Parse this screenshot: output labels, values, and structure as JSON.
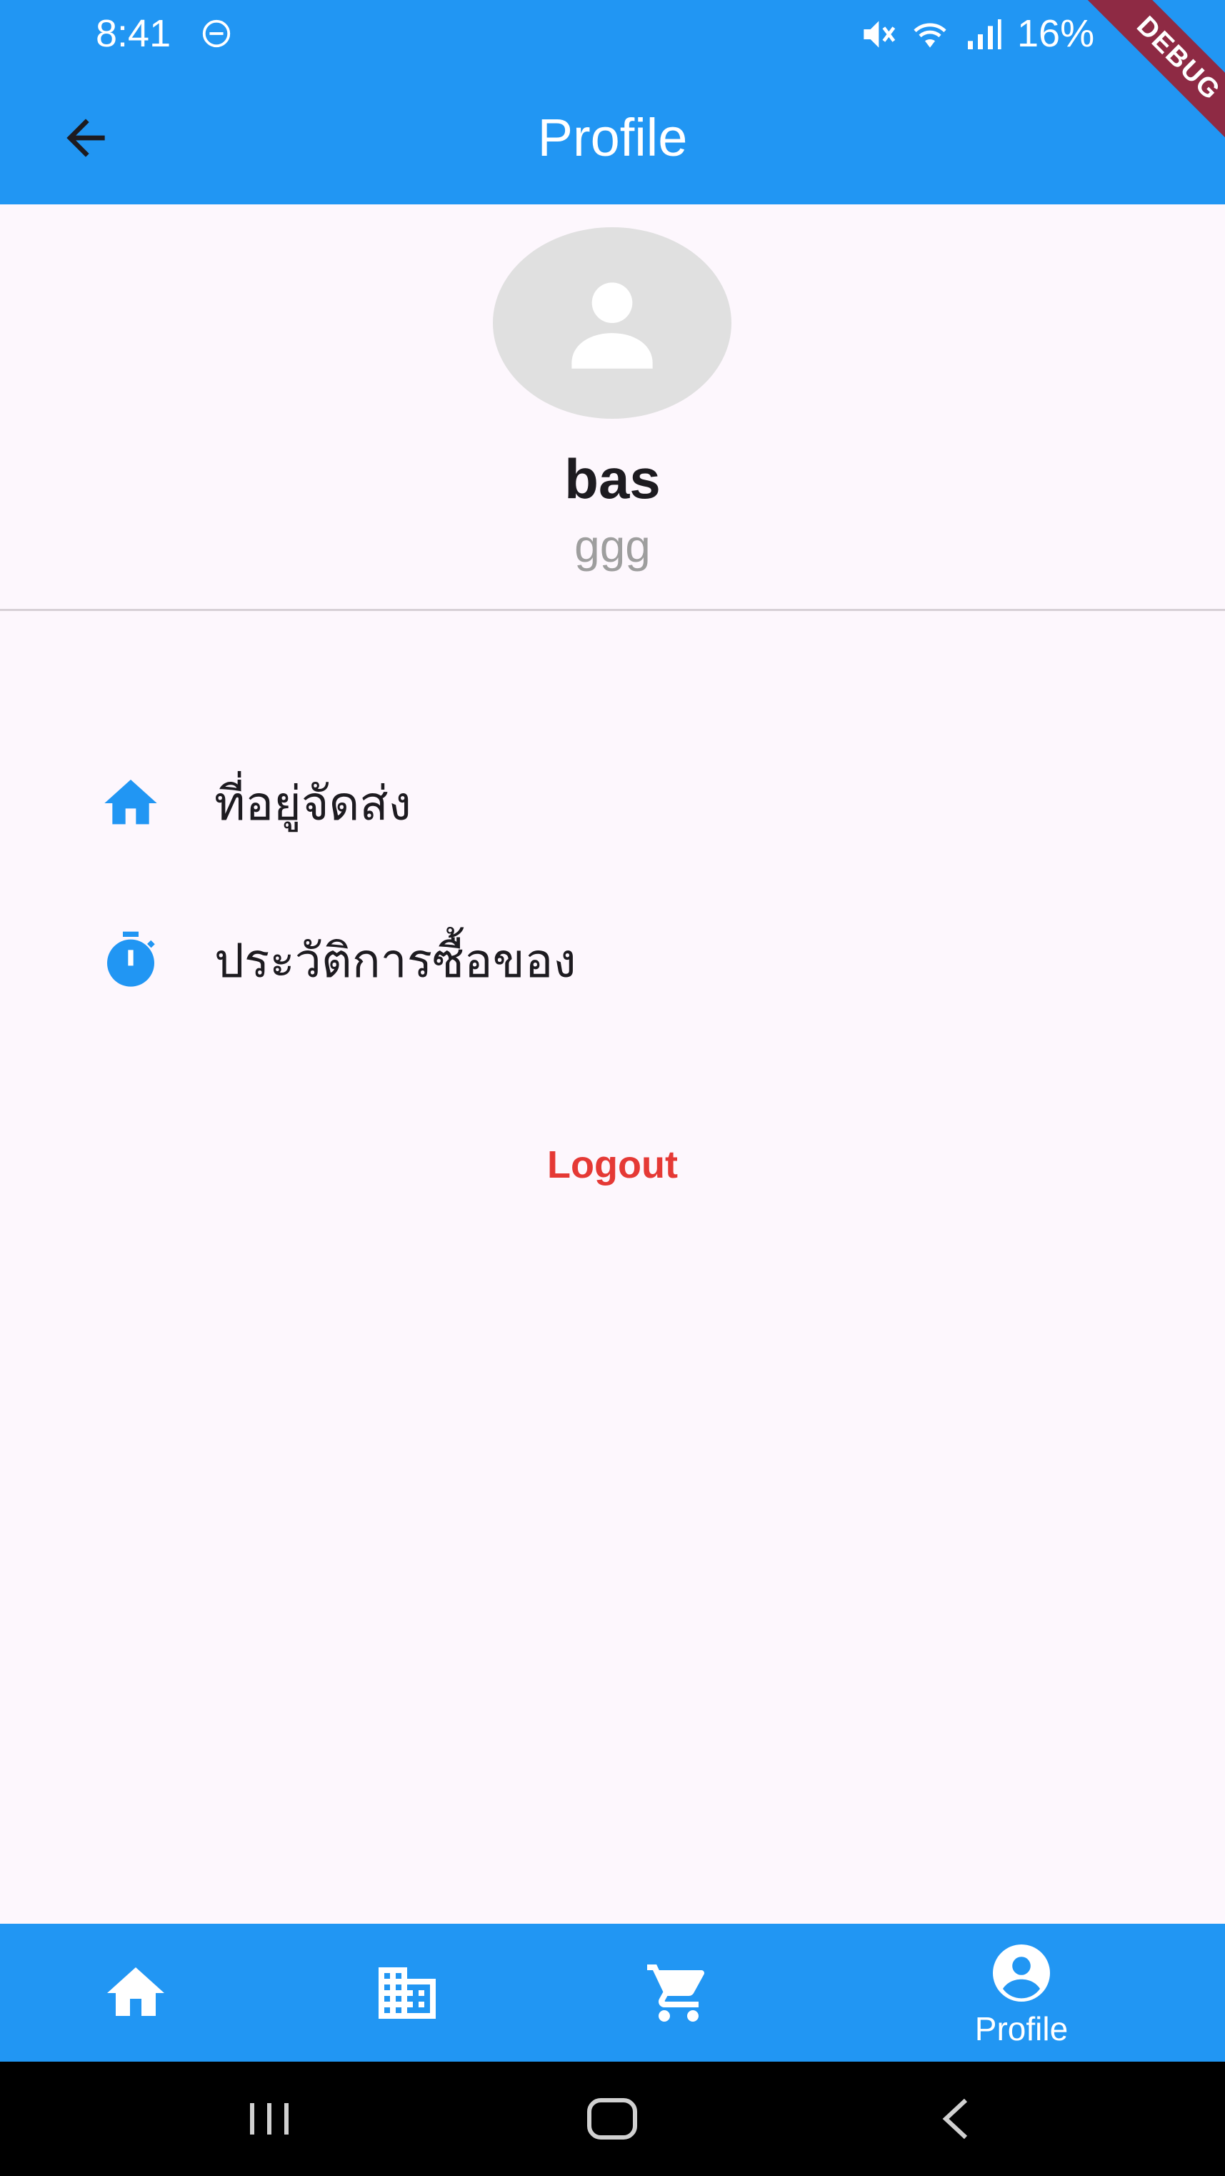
{
  "status_bar": {
    "time": "8:41",
    "battery": "16%",
    "icons": [
      "do-not-disturb-icon",
      "mute-icon",
      "wifi-icon",
      "signal-icon",
      "battery-icon"
    ]
  },
  "app_bar": {
    "title": "Profile",
    "debug_label": "DEBUG"
  },
  "profile": {
    "name": "bas",
    "email": "ggg"
  },
  "menu": {
    "items": [
      {
        "label": "ที่อยู่จัดส่ง",
        "icon": "home-icon"
      },
      {
        "label": "ประวัติการซื้อของ",
        "icon": "timer-icon"
      }
    ],
    "logout_label": "Logout"
  },
  "bottom_nav": {
    "items": [
      {
        "icon": "home-icon",
        "label": ""
      },
      {
        "icon": "business-icon",
        "label": ""
      },
      {
        "icon": "cart-icon",
        "label": ""
      },
      {
        "icon": "account-circle-icon",
        "label": "Profile"
      }
    ],
    "selected": "Profile"
  },
  "colors": {
    "primary": "#2196f3",
    "background": "#fdf7fd",
    "logout": "#e53935",
    "avatar_bg": "#e0e0e0"
  }
}
